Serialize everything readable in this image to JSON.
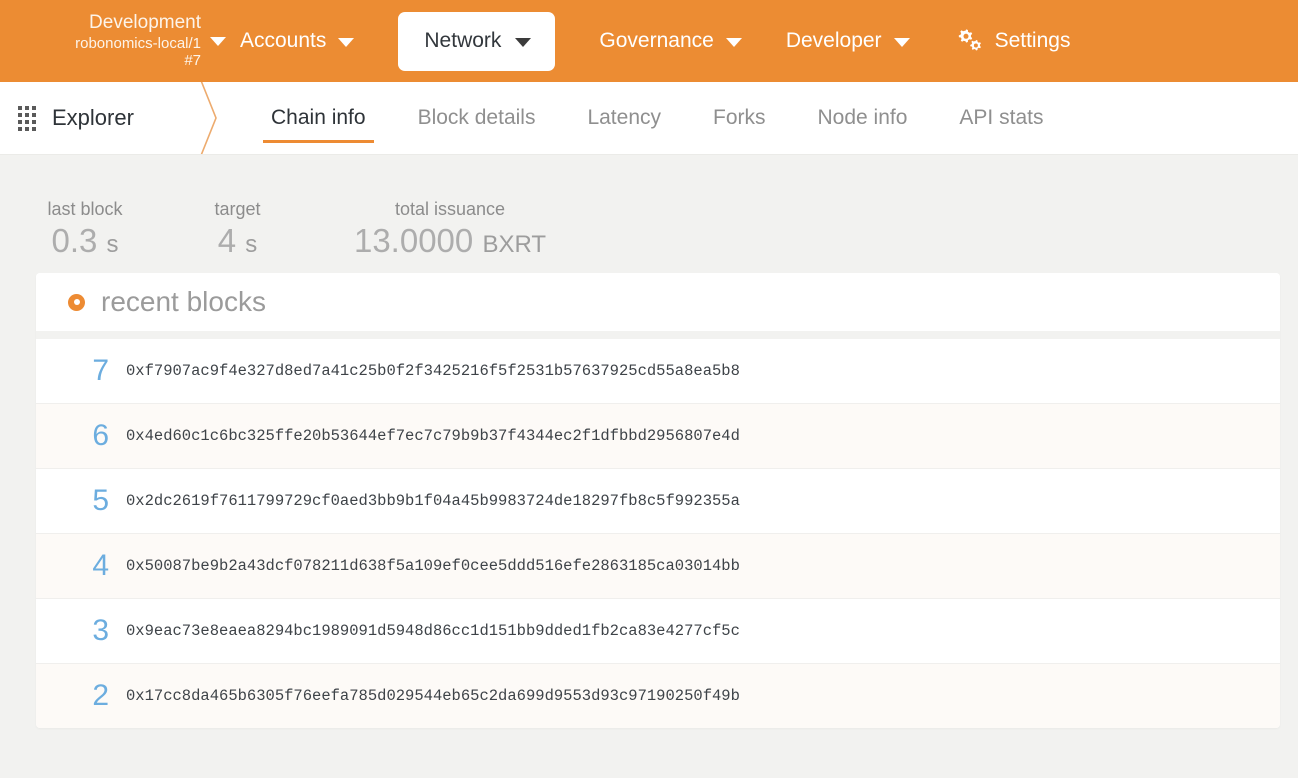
{
  "topbar": {
    "chain": {
      "name": "Development",
      "endpoint": "robonomics-local/1",
      "block": "#7",
      "caret_icon": "chevron-down-icon"
    },
    "nav": [
      {
        "label": "Accounts",
        "active": false,
        "caret_icon": "chevron-down-icon"
      },
      {
        "label": "Network",
        "active": true,
        "caret_icon": "chevron-down-icon"
      },
      {
        "label": "Governance",
        "active": false,
        "caret_icon": "chevron-down-icon"
      },
      {
        "label": "Developer",
        "active": false,
        "caret_icon": "chevron-down-icon"
      }
    ],
    "settings": {
      "label": "Settings",
      "icon": "gears-icon"
    },
    "bg_color": "#ec8c33"
  },
  "tabbar": {
    "section": {
      "label": "Explorer",
      "icon": "grid-dots-icon"
    },
    "tabs": [
      {
        "label": "Chain info",
        "active": true
      },
      {
        "label": "Block details",
        "active": false
      },
      {
        "label": "Latency",
        "active": false
      },
      {
        "label": "Forks",
        "active": false
      },
      {
        "label": "Node info",
        "active": false
      },
      {
        "label": "API stats",
        "active": false
      }
    ],
    "accent_color": "#ed8b33"
  },
  "summary": {
    "stats": [
      {
        "label": "last block",
        "value": "0.3",
        "unit": "s"
      },
      {
        "label": "target",
        "value": "4",
        "unit": "s"
      },
      {
        "label": "total issuance",
        "value": "13.0000",
        "unit": "BXRT"
      }
    ]
  },
  "recent_blocks": {
    "title": "recent blocks",
    "icon": "orange-ring-icon",
    "rows": [
      {
        "number": "7",
        "hash": "0xf7907ac9f4e327d8ed7a41c25b0f2f3425216f5f2531b57637925cd55a8ea5b8"
      },
      {
        "number": "6",
        "hash": "0x4ed60c1c6bc325ffe20b53644ef7ec7c79b9b37f4344ec2f1dfbbd2956807e4d"
      },
      {
        "number": "5",
        "hash": "0x2dc2619f7611799729cf0aed3bb9b1f04a45b9983724de18297fb8c5f992355a"
      },
      {
        "number": "4",
        "hash": "0x50087be9b2a43dcf078211d638f5a109ef0cee5ddd516efe2863185ca03014bb"
      },
      {
        "number": "3",
        "hash": "0x9eac73e8eaea8294bc1989091d5948d86cc1d151bb9dded1fb2ca83e4277cf5c"
      },
      {
        "number": "2",
        "hash": "0x17cc8da465b6305f76eefa785d029544eb65c2da699d9553d93c97190250f49b"
      }
    ]
  }
}
